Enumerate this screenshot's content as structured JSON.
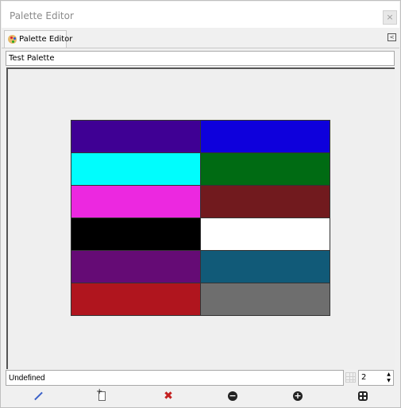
{
  "window": {
    "title": "Palette Editor",
    "close_icon": "×"
  },
  "tab": {
    "label": "Palette Editor",
    "icon": "palette-icon",
    "menu_icon": "<"
  },
  "palette_name": {
    "value": "Test Palette"
  },
  "swatches": [
    "#3f0094",
    "#0e00dc",
    "#00fdfd",
    "#006b13",
    "#ec28e0",
    "#711a1e",
    "#000000",
    "#ffffff",
    "#650b75",
    "#115a78",
    "#b0151e",
    "#6e6e6e"
  ],
  "columns": 2,
  "color_label": {
    "value": "Undefined"
  },
  "columns_spin": {
    "value": "2",
    "up": "▲",
    "down": "▼"
  },
  "toolbar": {
    "edit": "pencil-icon",
    "new": "new-color-icon",
    "delete": "✖",
    "zoom_out": "−",
    "zoom_in": "+",
    "zoom_all": "zoom-all-icon"
  }
}
